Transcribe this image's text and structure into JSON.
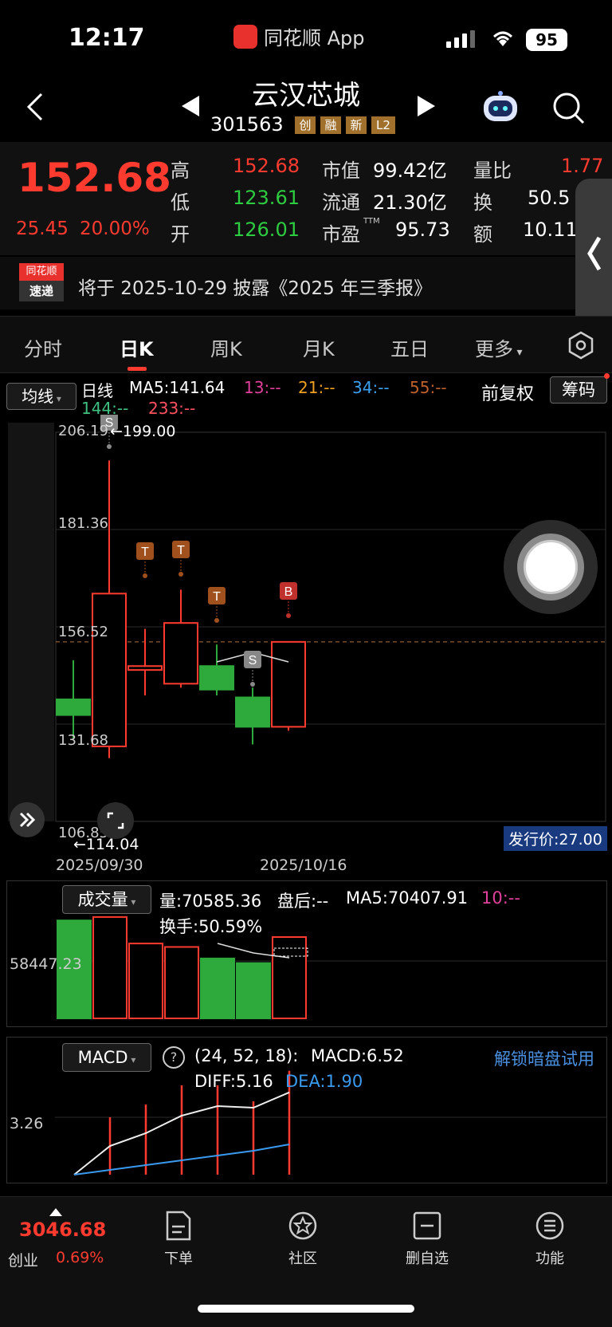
{
  "status": {
    "time": "12:17",
    "app_label": "同花顺 App",
    "battery": "95"
  },
  "header": {
    "name": "云汉芯城",
    "code": "301563",
    "tags": [
      "创",
      "融",
      "新",
      "L2"
    ]
  },
  "quote": {
    "price": "152.68",
    "change": "25.45",
    "pct": "20.00%",
    "high_label": "高",
    "high": "152.68",
    "low_label": "低",
    "low": "123.61",
    "open_label": "开",
    "open": "126.01",
    "mcap_label": "市值",
    "mcap": "99.42亿",
    "float_label": "流通",
    "float": "21.30亿",
    "pe_label": "市盈",
    "pe_sup": "TTM",
    "pe": "95.73",
    "vr_label": "量比",
    "vr": "1.77",
    "turnover_label": "换",
    "turnover": "50.5",
    "amount_label": "额",
    "amount": "10.11"
  },
  "news": {
    "logo_top": "同花顺",
    "logo_bottom": "速递",
    "text": "将于 2025-10-29 披露《2025 年三季报》"
  },
  "tabs": [
    "分时",
    "日K",
    "周K",
    "月K",
    "五日",
    "更多"
  ],
  "kline": {
    "ma_btn": "均线",
    "type_label": "日线",
    "ma5": "MA5:141.64",
    "ma13": "13:--",
    "ma21": "21:--",
    "ma34": "34:--",
    "ma55": "55:--",
    "ma144": "144:--",
    "ma233": "233:--",
    "adj": "前复权",
    "chip": "筹码",
    "y_labels": [
      "206.19",
      "181.36",
      "156.52",
      "131.68",
      "106.85"
    ],
    "max_label": "←199.00",
    "min_label": "←114.04",
    "x_labels": [
      "2025/09/30",
      "2025/10/16"
    ],
    "issue_price": "发行价:27.00",
    "markers": [
      "T",
      "T",
      "T",
      "S",
      "B",
      "S"
    ]
  },
  "chart_data": {
    "type": "candlestick",
    "ylim": [
      106.85,
      206.19
    ],
    "candles": [
      {
        "o": 138.0,
        "c": 134.0,
        "h": 148.0,
        "l": 128.0
      },
      {
        "o": 126.0,
        "c": 165.0,
        "h": 199.0,
        "l": 123.0
      },
      {
        "o": 145.5,
        "c": 146.5,
        "h": 156.0,
        "l": 139.0
      },
      {
        "o": 142.0,
        "c": 157.5,
        "h": 166.0,
        "l": 141.0
      },
      {
        "o": 146.5,
        "c": 140.5,
        "h": 152.0,
        "l": 139.0
      },
      {
        "o": 138.5,
        "c": 131.0,
        "h": 141.0,
        "l": 126.5
      },
      {
        "o": 131.0,
        "c": 152.68,
        "h": 152.68,
        "l": 130.0
      }
    ],
    "volume": {
      "label": "成交量",
      "vol": "量:70585.36",
      "after": "盘后:--",
      "ma5": "MA5:70407.91",
      "ma10": "10:--",
      "turnover": "换手:50.59%",
      "y_label": "58447.23",
      "values": [
        85000,
        88000,
        65000,
        62000,
        52000,
        48000,
        70585
      ]
    },
    "macd": {
      "label": "MACD",
      "params": "(24, 52, 18):",
      "macd": "MACD:6.52",
      "diff": "DIFF:5.16",
      "dea": "DEA:1.90",
      "y_label": "3.26",
      "unlock": "解锁暗盘试用",
      "hist": [
        0,
        3.6,
        4.4,
        5.6,
        5.6,
        4.6,
        6.52
      ],
      "diff_line": [
        0,
        1.8,
        2.6,
        3.7,
        4.3,
        4.2,
        5.16
      ],
      "dea_line": [
        0,
        0.3,
        0.6,
        0.9,
        1.2,
        1.5,
        1.9
      ]
    }
  },
  "bottom": {
    "index_val": "3046.68",
    "index_name": "创业",
    "index_pct": "0.69%",
    "nav": [
      "下单",
      "社区",
      "删自选",
      "功能"
    ]
  },
  "colors": {
    "up": "#ff3b30",
    "down": "#2eaa3c",
    "accent": "#4a90e2"
  }
}
